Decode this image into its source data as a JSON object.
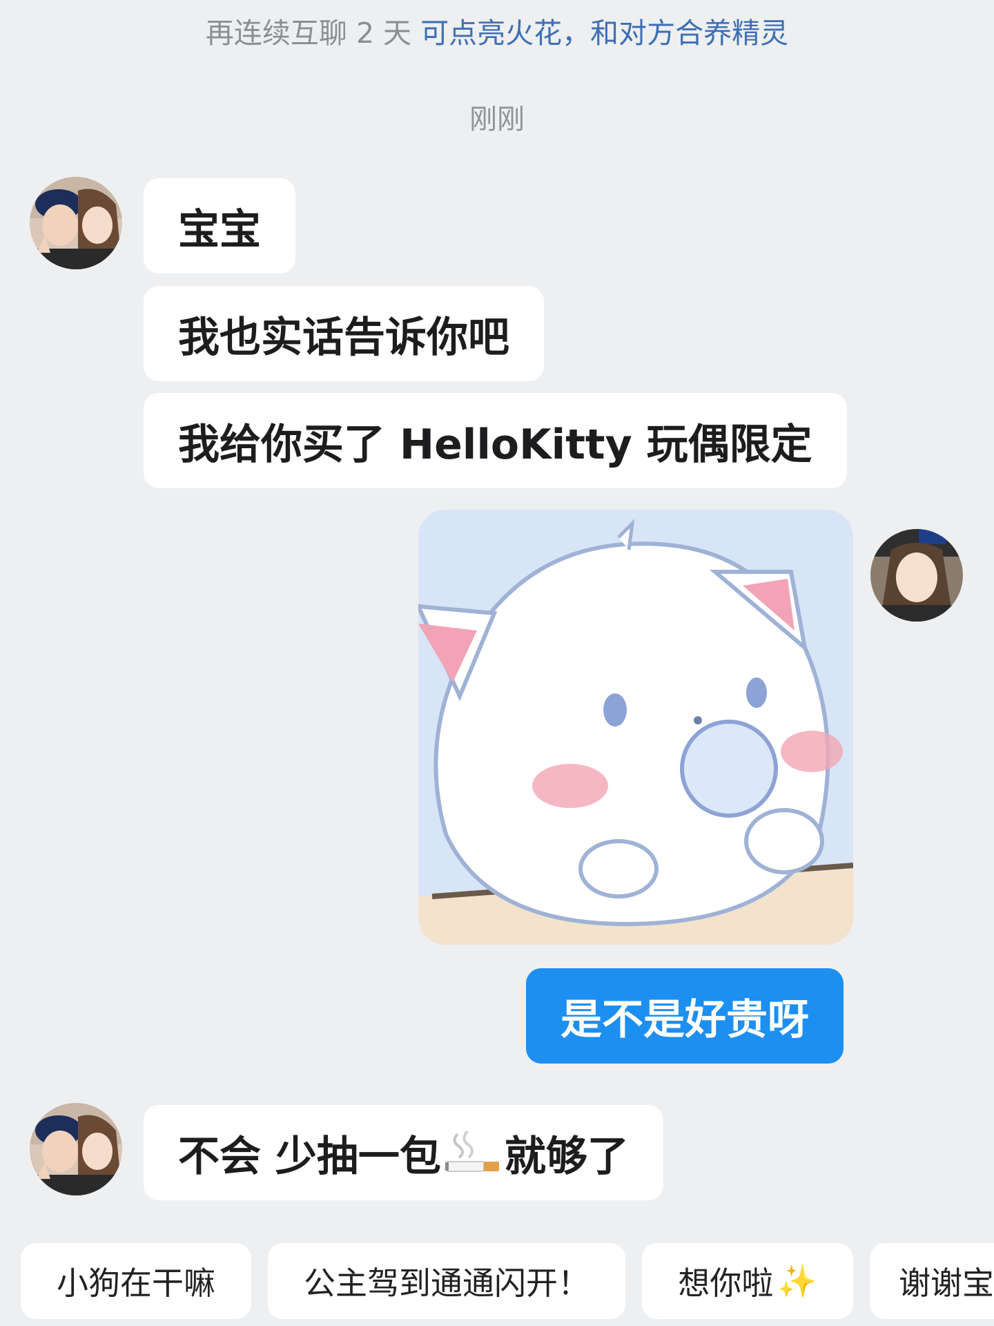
{
  "notice": {
    "prefix": "再连续互聊 2 天 ",
    "highlight": "可点亮火花，和对方合养精灵"
  },
  "timestamp": "刚刚",
  "messages": [
    {
      "sender": "friend",
      "text": "宝宝"
    },
    {
      "sender": "friend",
      "text": "我也实话告诉你吧"
    },
    {
      "sender": "friend",
      "text": "我给你买了 HelloKitty 玩偶限定"
    },
    {
      "sender": "me",
      "type": "sticker",
      "icon": "cute-cat-sticker"
    },
    {
      "sender": "me",
      "text": "是不是好贵呀"
    },
    {
      "sender": "friend",
      "text_before": "不会 少抽一包",
      "emoji": "cigarette-emoji",
      "text_after": "就够了"
    }
  ],
  "quick_replies": [
    {
      "label": "小狗在干嘛"
    },
    {
      "label": "公主驾到通通闪开！"
    },
    {
      "label": "想你啦",
      "emoji": "✨"
    },
    {
      "label": "谢谢宝"
    }
  ],
  "colors": {
    "background": "#eeeff1",
    "my_bubble": "#1d8ff0",
    "friend_bubble": "#ffffff",
    "notice_highlight": "#3d6fb3"
  }
}
